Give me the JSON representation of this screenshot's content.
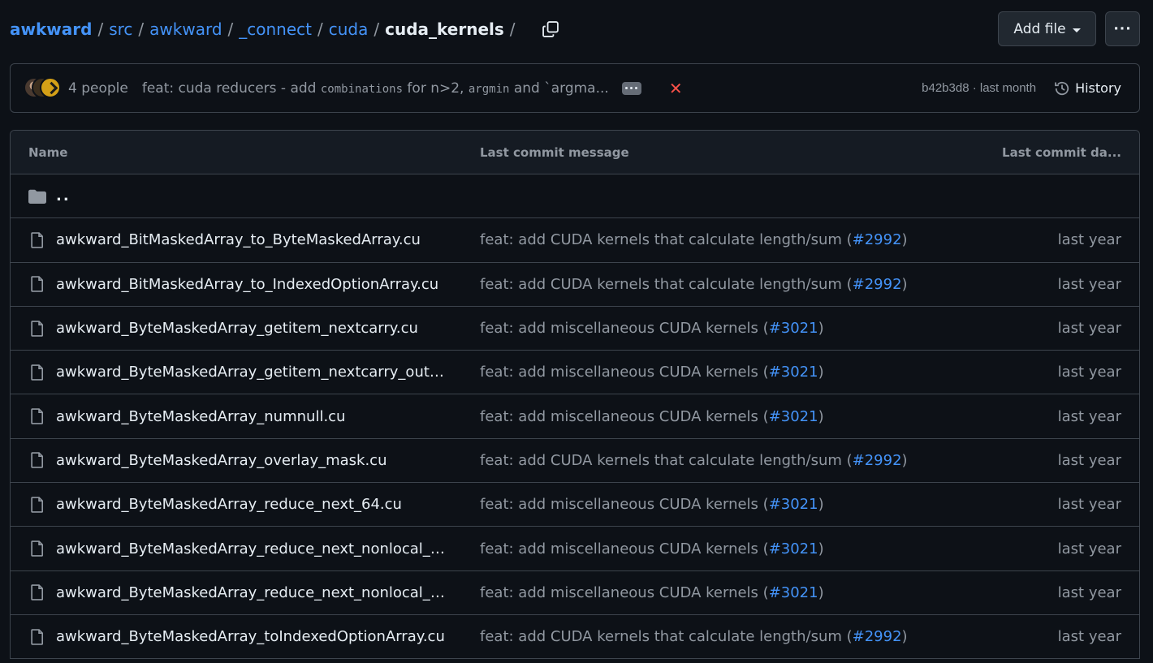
{
  "breadcrumb": {
    "root": "awkward",
    "parts": [
      "src",
      "awkward",
      "_connect",
      "cuda"
    ],
    "current": "cuda_kernels",
    "separator": "/"
  },
  "actions": {
    "add_file_label": "Add file",
    "more_label": "···"
  },
  "latest_commit": {
    "people": "4 people",
    "message_prefix": "feat: cuda reducers - add ",
    "message_code1": "combinations",
    "message_mid": " for n>2, ",
    "message_code2": "argmin",
    "message_suffix": " and `argma...",
    "sha_date": "b42b3d8 · last month",
    "history_label": "History"
  },
  "table": {
    "headers": {
      "name": "Name",
      "message": "Last commit message",
      "date": "Last commit da..."
    },
    "parent_dir": "..",
    "rows": [
      {
        "name": "awkward_BitMaskedArray_to_ByteMaskedArray.cu",
        "msg": "feat: add CUDA kernels that calculate length/sum (",
        "pr": "#2992",
        "date": "last year"
      },
      {
        "name": "awkward_BitMaskedArray_to_IndexedOptionArray.cu",
        "msg": "feat: add CUDA kernels that calculate length/sum (",
        "pr": "#2992",
        "date": "last year"
      },
      {
        "name": "awkward_ByteMaskedArray_getitem_nextcarry.cu",
        "msg": "feat: add miscellaneous CUDA kernels (",
        "pr": "#3021",
        "date": "last year"
      },
      {
        "name": "awkward_ByteMaskedArray_getitem_nextcarry_outin...",
        "msg": "feat: add miscellaneous CUDA kernels (",
        "pr": "#3021",
        "date": "last year"
      },
      {
        "name": "awkward_ByteMaskedArray_numnull.cu",
        "msg": "feat: add miscellaneous CUDA kernels (",
        "pr": "#3021",
        "date": "last year"
      },
      {
        "name": "awkward_ByteMaskedArray_overlay_mask.cu",
        "msg": "feat: add CUDA kernels that calculate length/sum (",
        "pr": "#2992",
        "date": "last year"
      },
      {
        "name": "awkward_ByteMaskedArray_reduce_next_64.cu",
        "msg": "feat: add miscellaneous CUDA kernels (",
        "pr": "#3021",
        "date": "last year"
      },
      {
        "name": "awkward_ByteMaskedArray_reduce_next_nonlocal_n...",
        "msg": "feat: add miscellaneous CUDA kernels (",
        "pr": "#3021",
        "date": "last year"
      },
      {
        "name": "awkward_ByteMaskedArray_reduce_next_nonlocal_n...",
        "msg": "feat: add miscellaneous CUDA kernels (",
        "pr": "#3021",
        "date": "last year"
      },
      {
        "name": "awkward_ByteMaskedArray_toIndexedOptionArray.cu",
        "msg": "feat: add CUDA kernels that calculate length/sum (",
        "pr": "#2992",
        "date": "last year"
      }
    ]
  },
  "colors": {
    "background": "#0d1117",
    "link": "#4493f8",
    "muted": "#9198a1",
    "border": "#3d444d",
    "error": "#f85149"
  },
  "icons": [
    "copy-icon",
    "caret-down-icon",
    "kebab-icon",
    "avatar",
    "ellipsis-icon",
    "x-icon",
    "history-icon",
    "folder-icon",
    "file-icon"
  ]
}
